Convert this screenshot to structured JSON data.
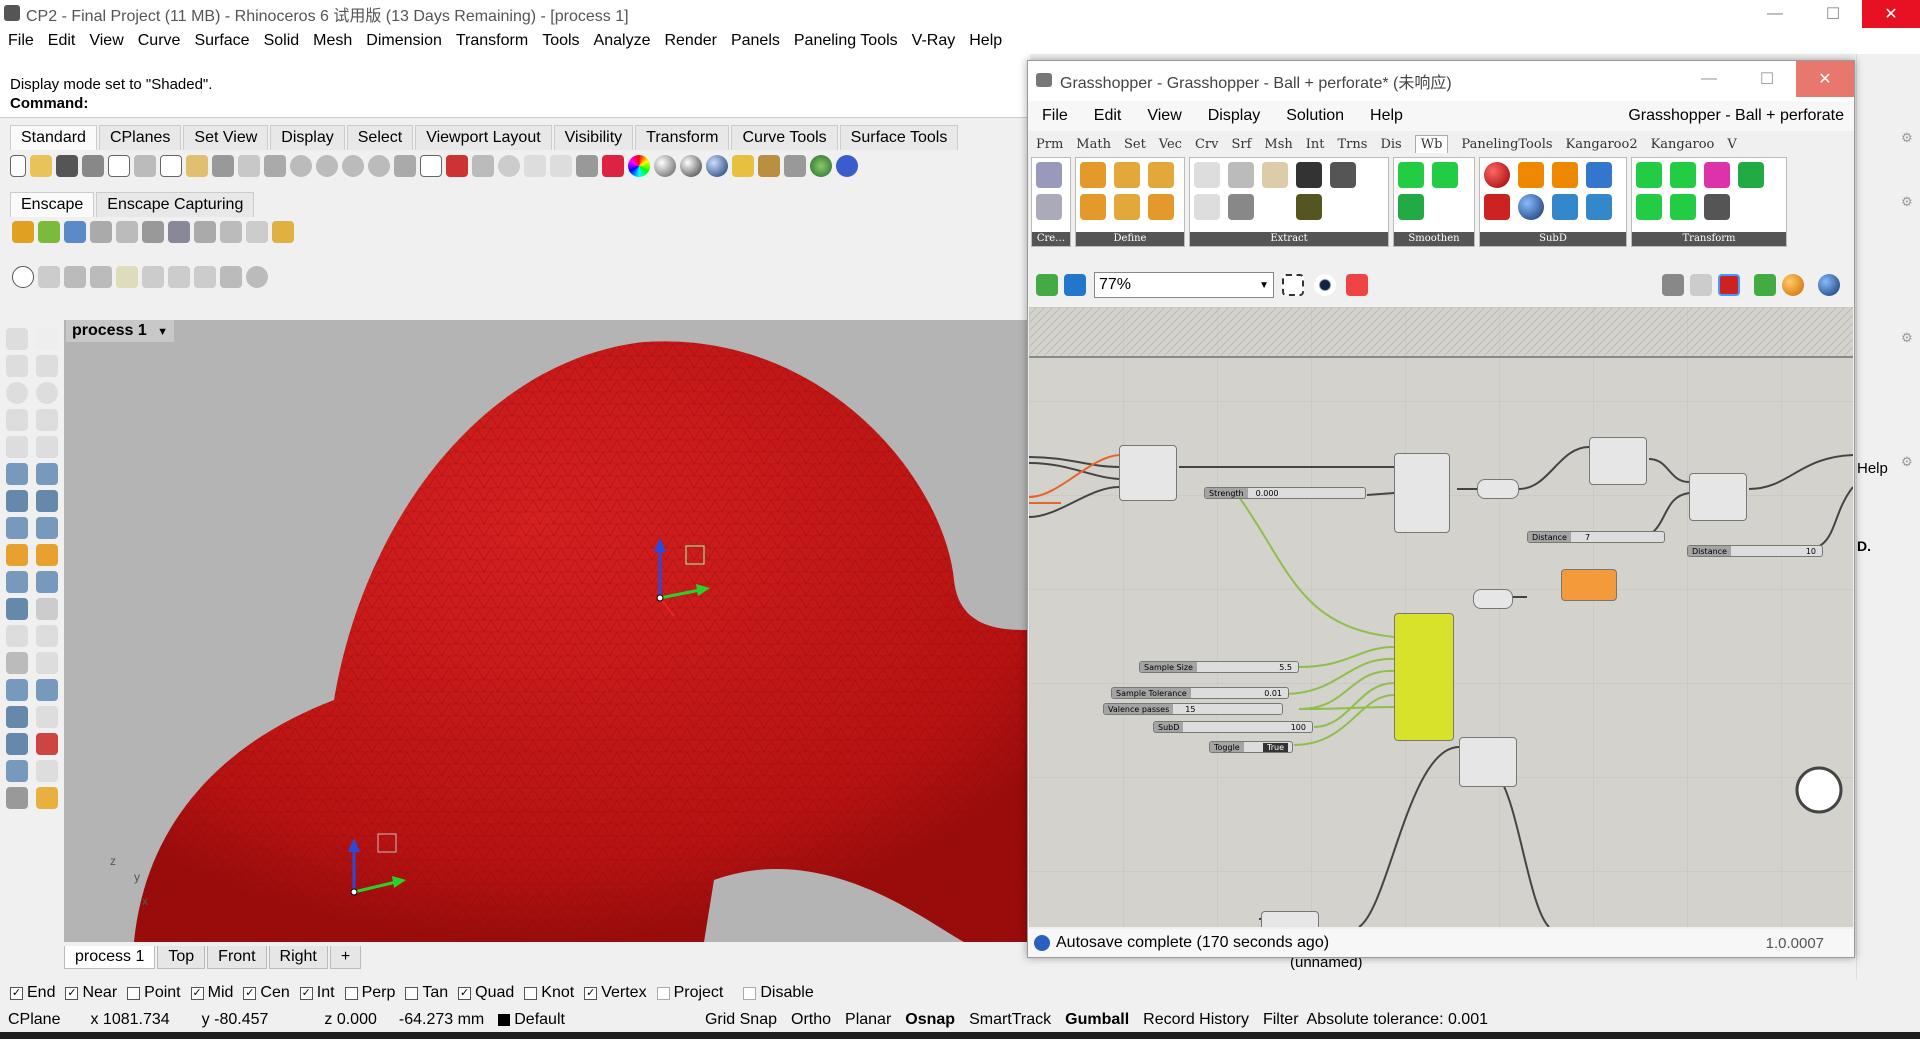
{
  "rhino": {
    "title": "CP2 - Final Project (11 MB) - Rhinoceros 6 试用版 (13 Days Remaining) - [process 1]",
    "menu": [
      "File",
      "Edit",
      "View",
      "Curve",
      "Surface",
      "Solid",
      "Mesh",
      "Dimension",
      "Transform",
      "Tools",
      "Analyze",
      "Render",
      "Panels",
      "Paneling Tools",
      "V-Ray",
      "Help"
    ],
    "command_history": "Display mode set to \"Shaded\".",
    "command_prompt": "Command:",
    "toolbar_tabs": [
      "Standard",
      "CPlanes",
      "Set View",
      "Display",
      "Select",
      "Viewport Layout",
      "Visibility",
      "Transform",
      "Curve Tools",
      "Surface Tools"
    ],
    "enscape_tabs": [
      "Enscape",
      "Enscape Capturing"
    ],
    "viewport_title": "process 1",
    "viewport_tabs": [
      "process 1",
      "Top",
      "Front",
      "Right"
    ],
    "viewport_add": "+",
    "axis": {
      "z": "z",
      "y": "y",
      "x": "x"
    },
    "osnaps": [
      {
        "label": "End",
        "checked": true
      },
      {
        "label": "Near",
        "checked": true
      },
      {
        "label": "Point",
        "checked": false
      },
      {
        "label": "Mid",
        "checked": true
      },
      {
        "label": "Cen",
        "checked": true
      },
      {
        "label": "Int",
        "checked": true
      },
      {
        "label": "Perp",
        "checked": false
      },
      {
        "label": "Tan",
        "checked": false
      },
      {
        "label": "Quad",
        "checked": true
      },
      {
        "label": "Knot",
        "checked": false
      },
      {
        "label": "Vertex",
        "checked": true
      },
      {
        "label": "Project",
        "checked": false
      },
      {
        "label": "Disable",
        "checked": false
      }
    ],
    "status": {
      "cplane": "CPlane",
      "x": "x 1081.734",
      "y": "y -80.457",
      "z": "z 0.000",
      "dist": "-64.273 mm",
      "layer": "Default",
      "grid_snap": "Grid Snap",
      "ortho": "Ortho",
      "planar": "Planar",
      "osnap": "Osnap",
      "smarttrack": "SmartTrack",
      "gumball": "Gumball",
      "record_history": "Record History",
      "filter": "Filter",
      "tolerance": "Absolute tolerance: 0.001"
    },
    "right_panel": {
      "help": "Help",
      "d": "D.",
      "layer": "(unnamed)"
    }
  },
  "grasshopper": {
    "title": "Grasshopper - Grasshopper - Ball + perforate* (未响应)",
    "menu": [
      "File",
      "Edit",
      "View",
      "Display",
      "Solution",
      "Help"
    ],
    "doc_name": "Grasshopper - Ball + perforate",
    "tabs": [
      "Prm",
      "Math",
      "Set",
      "Vec",
      "Crv",
      "Srf",
      "Msh",
      "Int",
      "Trns",
      "Dis",
      "Wb",
      "PanelingTools",
      "Kangaroo2",
      "Kangaroo",
      "V"
    ],
    "active_tab": "Wb",
    "ribbon_groups": [
      "Cre…",
      "Define",
      "Extract",
      "Smoothen",
      "SubD",
      "Transform"
    ],
    "zoom": "77%",
    "sliders": [
      {
        "name": "Strength",
        "value": "0.000"
      },
      {
        "name": "Distance",
        "value": "7"
      },
      {
        "name": "Distance",
        "value": "10"
      },
      {
        "name": "Sample Size",
        "value": "5.5"
      },
      {
        "name": "Sample Tolerance",
        "value": "0.01"
      },
      {
        "name": "Valence passes",
        "value": "15"
      },
      {
        "name": "SubD",
        "value": "100"
      }
    ],
    "toggle": {
      "name": "Toggle",
      "value": "True"
    },
    "status": "Autosave complete (170 seconds ago)",
    "version": "1.0.0007"
  },
  "colors": {
    "mesh": "#c41414",
    "gh_canvas": "#d4d2cc",
    "yellow_node": "#d8e22a",
    "orange_node": "#f39a3a"
  }
}
